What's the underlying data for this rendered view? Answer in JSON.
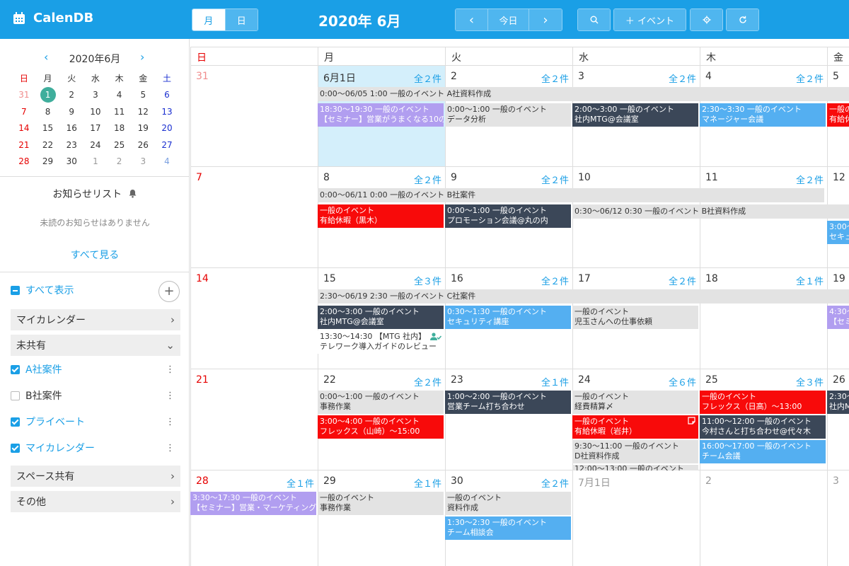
{
  "header": {
    "app_name": "CalenDB",
    "view_month": "月",
    "view_day": "日",
    "title": "2020年 6月",
    "prev": "‹",
    "today": "今日",
    "next": "›",
    "add_event": "＋ イベント",
    "accent": "#1a9fe6"
  },
  "mini_calendar": {
    "title": "2020年6月",
    "weekdays": [
      "日",
      "月",
      "火",
      "水",
      "木",
      "金",
      "土"
    ],
    "weeks": [
      [
        "31",
        "1",
        "2",
        "3",
        "4",
        "5",
        "6"
      ],
      [
        "7",
        "8",
        "9",
        "10",
        "11",
        "12",
        "13"
      ],
      [
        "14",
        "15",
        "16",
        "17",
        "18",
        "19",
        "20"
      ],
      [
        "21",
        "22",
        "23",
        "24",
        "25",
        "26",
        "27"
      ],
      [
        "28",
        "29",
        "30",
        "1",
        "2",
        "3",
        "4"
      ]
    ]
  },
  "notice": {
    "title": "お知らせリスト",
    "message": "未読のお知らせはありません",
    "view_all": "すべて見る"
  },
  "calendars": {
    "show_all": "すべて表示",
    "group_my": "マイカレンダー",
    "group_unshared": "未共有",
    "item_a": "A社案件",
    "item_b": "B社案件",
    "item_private": "プライベート",
    "item_mycal": "マイカレンダー",
    "group_space": "スペース共有",
    "group_other": "その他"
  },
  "grid": {
    "weekdays": [
      "日",
      "月",
      "火",
      "水",
      "木",
      "金"
    ],
    "weeks": [
      {
        "days": [
          "31",
          "6月1日",
          "2",
          "3",
          "4",
          "5"
        ],
        "counts": [
          "",
          "全２件",
          "全２件",
          "全２件",
          "全２件",
          ""
        ]
      },
      {
        "days": [
          "7",
          "8",
          "9",
          "10",
          "11",
          "12"
        ],
        "counts": [
          "",
          "全２件",
          "全２件",
          "",
          "全２件",
          ""
        ]
      },
      {
        "days": [
          "14",
          "15",
          "16",
          "17",
          "18",
          "19"
        ],
        "counts": [
          "",
          "全３件",
          "全２件",
          "全２件",
          "全１件",
          ""
        ]
      },
      {
        "days": [
          "21",
          "22",
          "23",
          "24",
          "25",
          "26"
        ],
        "counts": [
          "",
          "全２件",
          "全１件",
          "全６件",
          "全３件",
          ""
        ]
      },
      {
        "days": [
          "28",
          "29",
          "30",
          "7月1日",
          "2",
          "3"
        ],
        "counts": [
          "全１件",
          "",
          "全１件",
          "全２件",
          "",
          ""
        ]
      }
    ],
    "spans": {
      "s1": "0:00〜06/05 1:00 一般のイベント A社資料作成",
      "s2": "0:00〜06/11 0:00 一般のイベント B社案件",
      "s3": "0:30〜06/12 0:30 一般のイベント B社資料作成",
      "s4": "2:30〜06/19 2:30 一般のイベント C社案件"
    },
    "events": {
      "w1_mon_1": "18:30〜19:30 一般のイベント",
      "w1_mon_2": "【セミナー】営業がうまくなる10の",
      "w1_tue_1": "0:00〜1:00 一般のイベント",
      "w1_tue_2": "データ分析",
      "w1_wed_1": "2:00〜3:00 一般のイベント",
      "w1_wed_2": "社内MTG@会議室",
      "w1_thu_1": "2:30〜3:30 一般のイベント",
      "w1_thu_2": "マネージャー会議",
      "w1_fri_1": "一般の",
      "w1_fri_2": "有給休",
      "w2_mon_1": "一般のイベント",
      "w2_mon_2": "有給休暇（黒木）",
      "w2_tue_1": "0:00〜1:00 一般のイベント",
      "w2_tue_2": "プロモーション会議@丸の内",
      "w2_fri_1": "3:00〜",
      "w2_fri_2": "セキュ",
      "w3_mon_1": "2:00〜3:00 一般のイベント",
      "w3_mon_2": "社内MTG@会議室",
      "w3_mon_3": "13:30〜14:30 【MTG 社内】",
      "w3_mon_4": "テレワーク導入ガイドのレビュー",
      "w3_tue_1": "0:30〜1:30 一般のイベント",
      "w3_tue_2": "セキュリティ講座",
      "w3_wed_1": "一般のイベント",
      "w3_wed_2": "児玉さんへの仕事依頼",
      "w3_fri_1": "4:30〜",
      "w3_fri_2": "【セミ",
      "w4_mon_1": "0:00〜1:00 一般のイベント",
      "w4_mon_2": "事務作業",
      "w4_mon_3": "3:00〜4:00 一般のイベント",
      "w4_mon_4": "フレックス（山崎）〜15:00",
      "w4_tue_1": "1:00〜2:00 一般のイベント",
      "w4_tue_2": "営業チーム打ち合わせ",
      "w4_wed_1": "一般のイベント",
      "w4_wed_2": "経費精算〆",
      "w4_wed_3": "一般のイベント",
      "w4_wed_4": "有給休暇（岩井）",
      "w4_wed_5": "9:30〜11:00 一般のイベント",
      "w4_wed_6": "D社資料作成",
      "w4_wed_7": "12:00〜13:00 一般のイベント",
      "w4_thu_1": "一般のイベント",
      "w4_thu_2": "フレックス（日高）〜13:00",
      "w4_thu_3": "11:00〜12:00 一般のイベント",
      "w4_thu_4": "今村さんと打ち合わせ@代々木",
      "w4_thu_5": "16:00〜17:00 一般のイベント",
      "w4_thu_6": "チーム会議",
      "w4_fri_1": "2:30〜",
      "w4_fri_2": "社内M",
      "w5_sun_1": "3:30〜17:30 一般のイベント",
      "w5_sun_2": "【セミナー】営業・マーケティング",
      "w5_mon_1": "一般のイベント",
      "w5_mon_2": "事務作業",
      "w5_tue_1": "一般のイベント",
      "w5_tue_2": "資料作成",
      "w5_tue_3": "1:30〜2:30 一般のイベント",
      "w5_tue_4": "チーム相談会"
    }
  }
}
